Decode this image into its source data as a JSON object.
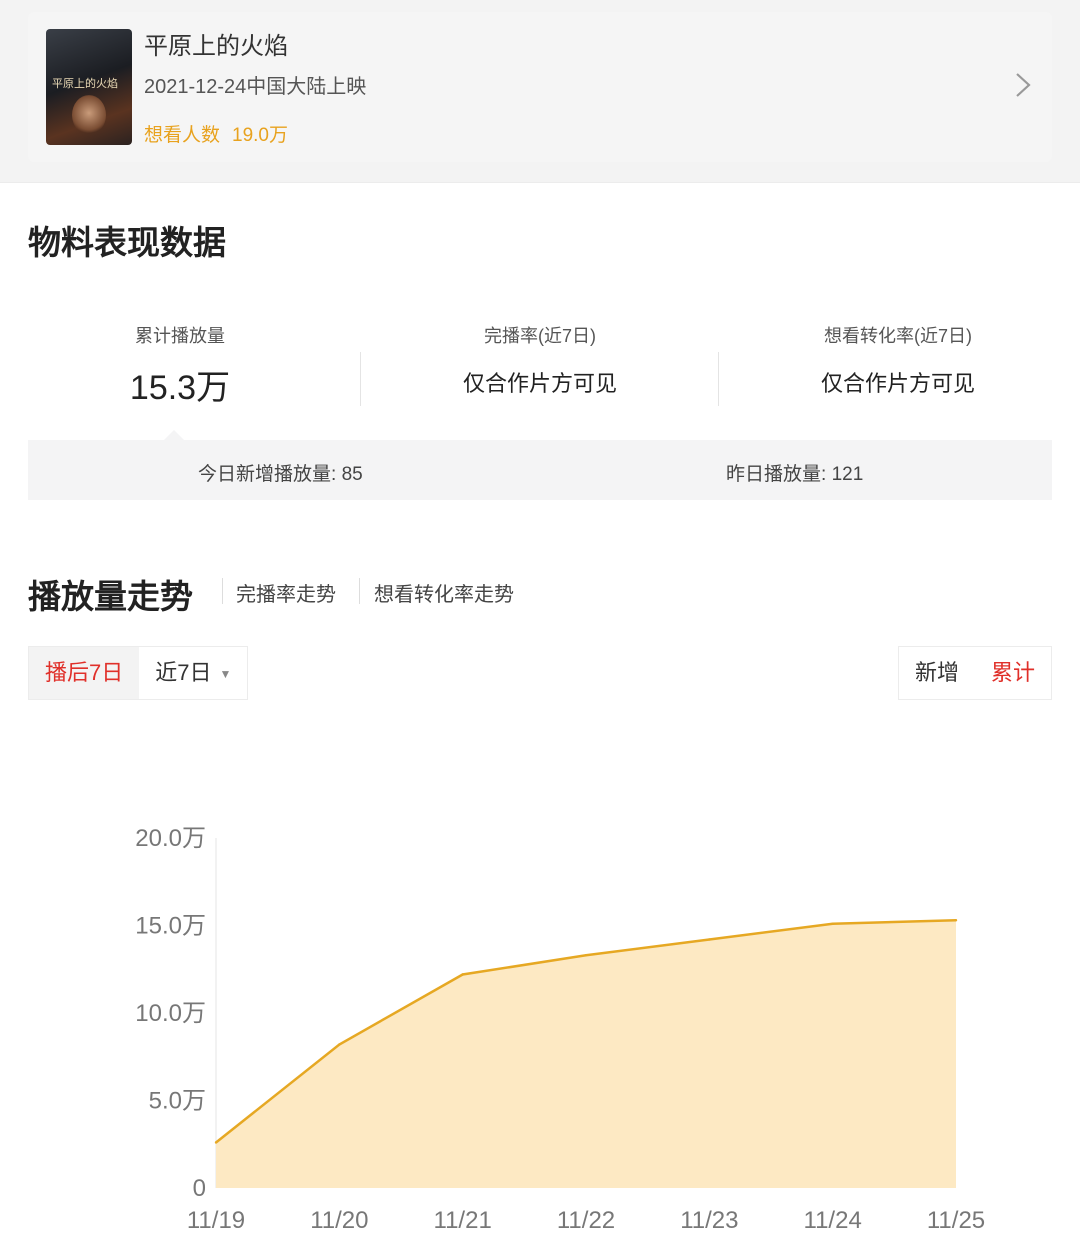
{
  "movie": {
    "title": "平原上的火焰",
    "release": "2021-12-24中国大陆上映",
    "want_label": "想看人数",
    "want_value": "19.0万"
  },
  "section_title": "物料表现数据",
  "stats": [
    {
      "label": "累计播放量",
      "value": "15.3万"
    },
    {
      "label": "完播率(近7日)",
      "value": "仅合作片方可见"
    },
    {
      "label": "想看转化率(近7日)",
      "value": "仅合作片方可见"
    }
  ],
  "daily": {
    "today_label": "今日新增播放量:",
    "today_value": "85",
    "yesterday_label": "昨日播放量:",
    "yesterday_value": "121"
  },
  "trend": {
    "title": "播放量走势",
    "tabs": [
      "完播率走势",
      "想看转化率走势"
    ],
    "range_buttons": [
      "播后7日",
      "近7日"
    ],
    "mode_buttons": [
      "新增",
      "累计"
    ]
  },
  "colors": {
    "accent_red": "#e0302a",
    "line": "#e6a823",
    "fill": "#fde9c3",
    "want": "#e8a21e"
  },
  "chart_data": {
    "type": "area",
    "categories": [
      "11/19",
      "11/20",
      "11/21",
      "11/22",
      "11/23",
      "11/24",
      "11/25"
    ],
    "values": [
      2.6,
      8.2,
      12.2,
      13.3,
      14.2,
      15.1,
      15.3
    ],
    "yticks": [
      "0",
      "5.0万",
      "10.0万",
      "15.0万",
      "20.0万"
    ],
    "ylim": [
      0,
      20
    ],
    "grid": false
  }
}
